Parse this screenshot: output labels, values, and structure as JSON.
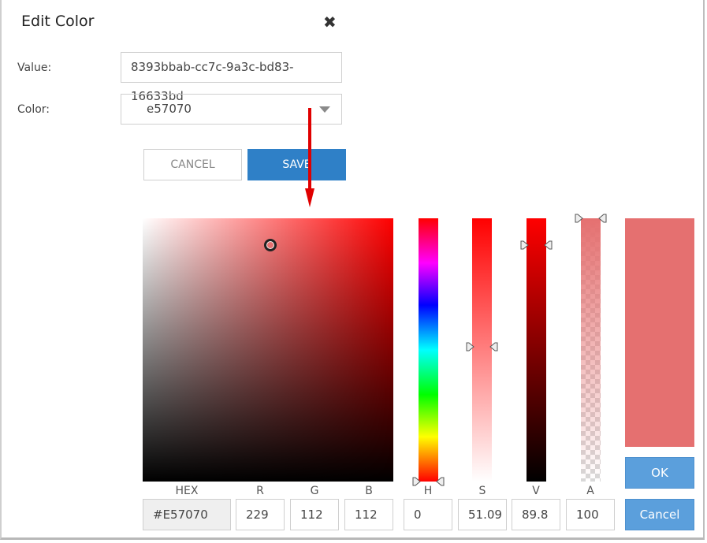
{
  "dialog": {
    "title": "Edit Color",
    "close_icon": "close-x-icon"
  },
  "form": {
    "value_label": "Value:",
    "value_text": "8393bbab-cc7c-9a3c-bd83-16633bd",
    "color_label": "Color:",
    "color_selected": "e57070"
  },
  "actions": {
    "cancel_label": "CANCEL",
    "save_label": "SAVE"
  },
  "annotation": {
    "arrow_color": "#e00000",
    "arrow_direction": "down"
  },
  "picker": {
    "current_color": "#e57070",
    "hue_color": "#ff0000",
    "labels": {
      "hex": "HEX",
      "r": "R",
      "g": "G",
      "b": "B",
      "h": "H",
      "s": "S",
      "v": "V",
      "a": "A"
    },
    "values": {
      "hex": "#E57070",
      "r": "229",
      "g": "112",
      "b": "112",
      "h": "0",
      "s": "51.09",
      "v": "89.8",
      "a": "100"
    },
    "hue_fraction": 0,
    "saturation_fraction": 0.5109,
    "value_fraction": 0.898,
    "alpha_fraction": 1.0,
    "ok_label": "OK",
    "cancel_label": "Cancel"
  },
  "colors": {
    "primary_button": "#2f80c7",
    "picker_button": "#5b9fdc"
  }
}
